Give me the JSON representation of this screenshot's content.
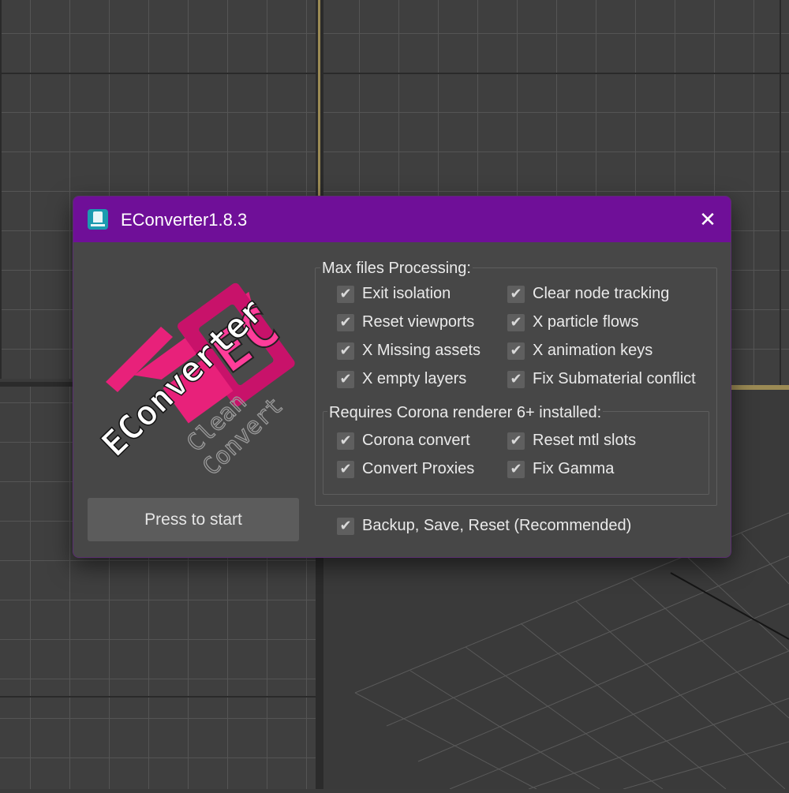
{
  "window": {
    "title": "EConverter1.8.3",
    "close_glyph": "✕",
    "title_bar_color": "#6f0f98",
    "icon": "app-icon"
  },
  "logo": {
    "main_text": "EConverter",
    "sub_line_1": "Clean",
    "sub_line_2": "Convert",
    "monogram": "EC",
    "accent_color": "#e8217a"
  },
  "start_button": {
    "label": "Press to start"
  },
  "max_group": {
    "title": "Max files Processing:",
    "left_col": [
      {
        "label": "Exit isolation",
        "checked": true
      },
      {
        "label": "Reset viewports",
        "checked": true
      },
      {
        "label": "X Missing assets",
        "checked": true
      },
      {
        "label": "X empty layers",
        "checked": true
      }
    ],
    "right_col": [
      {
        "label": "Clear node tracking",
        "checked": true
      },
      {
        "label": "X particle flows",
        "checked": true
      },
      {
        "label": "X animation keys",
        "checked": true
      },
      {
        "label": "Fix Submaterial conflict",
        "checked": true
      }
    ]
  },
  "corona_group": {
    "title": "Requires Corona renderer 6+ installed:",
    "left_col": [
      {
        "label": "Corona convert",
        "checked": true
      },
      {
        "label": "Convert Proxies",
        "checked": true
      }
    ],
    "right_col": [
      {
        "label": "Reset mtl slots",
        "checked": true
      },
      {
        "label": "Fix Gamma",
        "checked": true
      }
    ]
  },
  "backup": {
    "label": "Backup, Save, Reset (Recommended)",
    "checked": true
  },
  "check_glyph": "✔"
}
